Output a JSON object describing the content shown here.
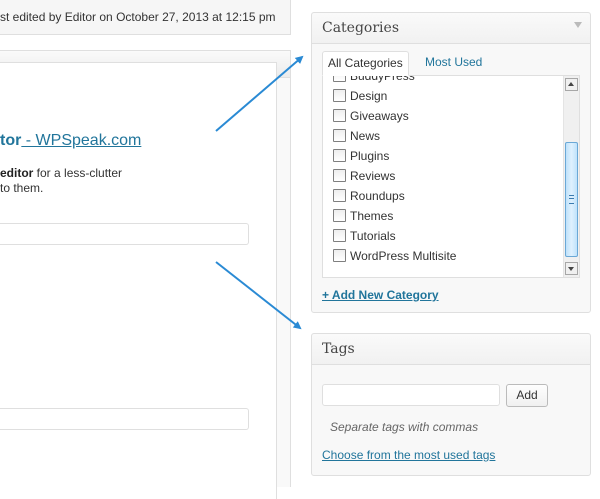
{
  "editor": {
    "last_edited": "st edited by Editor on October 27, 2013 at 12:15 pm",
    "post_link_bold": "tor",
    "post_link_rest": " - WPSpeak.com",
    "line1_bold": "editor",
    "line1_rest": " for a less-clutter",
    "line2": "to them."
  },
  "categories": {
    "title": "Categories",
    "tab_all": "All Categories",
    "tab_most_used": "Most Used",
    "partial_item": "BuddyPress",
    "items": [
      {
        "label": "Design",
        "checked": false
      },
      {
        "label": "Giveaways",
        "checked": false
      },
      {
        "label": "News",
        "checked": false
      },
      {
        "label": "Plugins",
        "checked": false
      },
      {
        "label": "Reviews",
        "checked": false
      },
      {
        "label": "Roundups",
        "checked": false
      },
      {
        "label": "Themes",
        "checked": false
      },
      {
        "label": "Tutorials",
        "checked": false
      },
      {
        "label": "WordPress Multisite",
        "checked": false
      }
    ],
    "add_new": "+ Add New Category"
  },
  "tags": {
    "title": "Tags",
    "input_value": "",
    "add_button": "Add",
    "hint": "Separate tags with commas",
    "choose_link": "Choose from the most used tags"
  },
  "colors": {
    "link": "#21759b",
    "arrow": "#2a8ad4",
    "border": "#dfdfdf",
    "scroll_thumb": "#bfe2fb"
  }
}
